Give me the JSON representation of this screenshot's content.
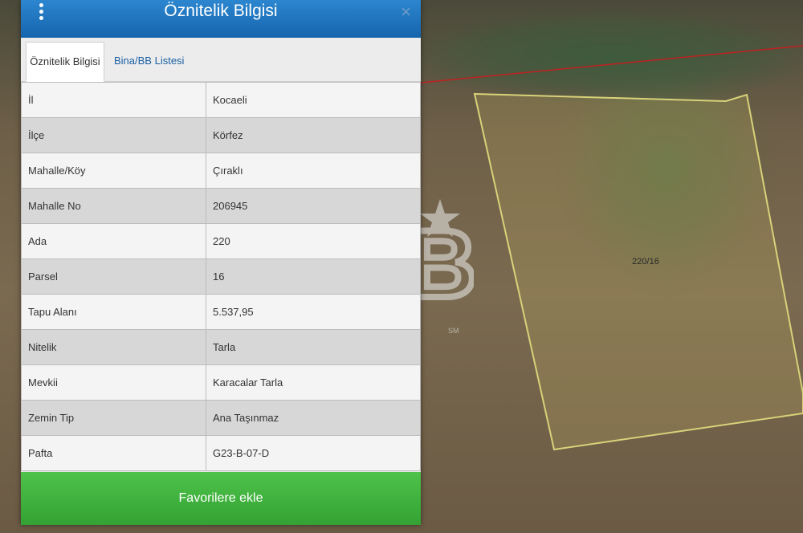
{
  "header": {
    "title": "Öznitelik Bilgisi",
    "close_label": "×"
  },
  "tabs": [
    {
      "label": "Öznitelik Bilgisi",
      "active": true
    },
    {
      "label": "Bina/BB Listesi",
      "active": false
    }
  ],
  "rows": [
    {
      "key": "İl",
      "value": "Kocaeli"
    },
    {
      "key": "İlçe",
      "value": "Körfez"
    },
    {
      "key": "Mahalle/Köy",
      "value": "Çıraklı"
    },
    {
      "key": "Mahalle No",
      "value": "206945"
    },
    {
      "key": "Ada",
      "value": "220"
    },
    {
      "key": "Parsel",
      "value": "16"
    },
    {
      "key": "Tapu Alanı",
      "value": "5.537,95"
    },
    {
      "key": "Nitelik",
      "value": "Tarla"
    },
    {
      "key": "Mevkii",
      "value": "Karacalar Tarla"
    },
    {
      "key": "Zemin Tip",
      "value": "Ana Taşınmaz"
    },
    {
      "key": "Pafta",
      "value": "G23-B-07-D"
    }
  ],
  "footer": {
    "button_label": "Favorilere ekle"
  },
  "map": {
    "parcel_label": "220/16",
    "watermark_text": "CB",
    "watermark_mark": "SM"
  },
  "colors": {
    "header": "#1f77c1",
    "button": "#3fb23e",
    "parcel_outline": "#d8d27a",
    "road_line": "#c02020"
  }
}
